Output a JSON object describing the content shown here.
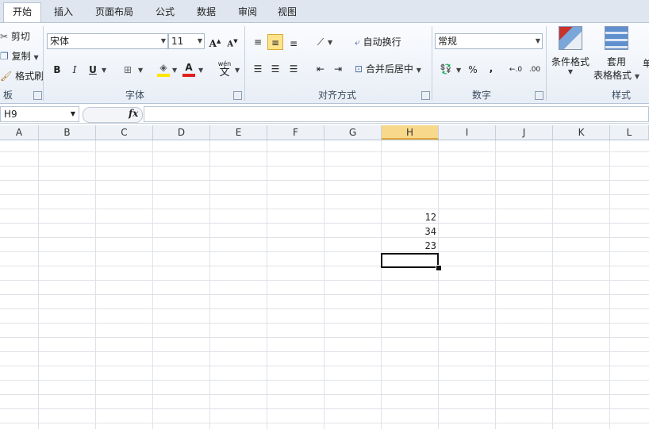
{
  "tabs": [
    {
      "label": "开始",
      "active": true
    },
    {
      "label": "插入",
      "active": false
    },
    {
      "label": "页面布局",
      "active": false
    },
    {
      "label": "公式",
      "active": false
    },
    {
      "label": "数据",
      "active": false
    },
    {
      "label": "审阅",
      "active": false
    },
    {
      "label": "视图",
      "active": false
    }
  ],
  "clipboard": {
    "cut": "剪切",
    "copy": "复制",
    "format_painter": "格式刷",
    "label": "板"
  },
  "font": {
    "name": "宋体",
    "size": "11",
    "label": "字体",
    "bold": "B",
    "italic": "I",
    "underline": "U",
    "wen": "wén",
    "wen_char": "文"
  },
  "alignment": {
    "wrap": "自动换行",
    "merge": "合并后居中",
    "label": "对齐方式"
  },
  "number": {
    "format": "常规",
    "percent": "%",
    "comma": ",",
    "label": "数字"
  },
  "styles": {
    "cond_format": "条件格式",
    "table_line1": "套用",
    "table_line2": "表格格式",
    "cell_trunc": "单",
    "label": "样式"
  },
  "formula_bar": {
    "name_box": "H9",
    "fx": "fx"
  },
  "columns": [
    "A",
    "B",
    "C",
    "D",
    "E",
    "F",
    "G",
    "H",
    "I",
    "J",
    "K",
    "L"
  ],
  "active_column": "H",
  "cells": {
    "h6": "12",
    "h7": "34",
    "h8": "23"
  },
  "colors": {
    "accent_fill": "#fde48a",
    "font_color": "#e02020",
    "fill_color": "#ffe600"
  }
}
